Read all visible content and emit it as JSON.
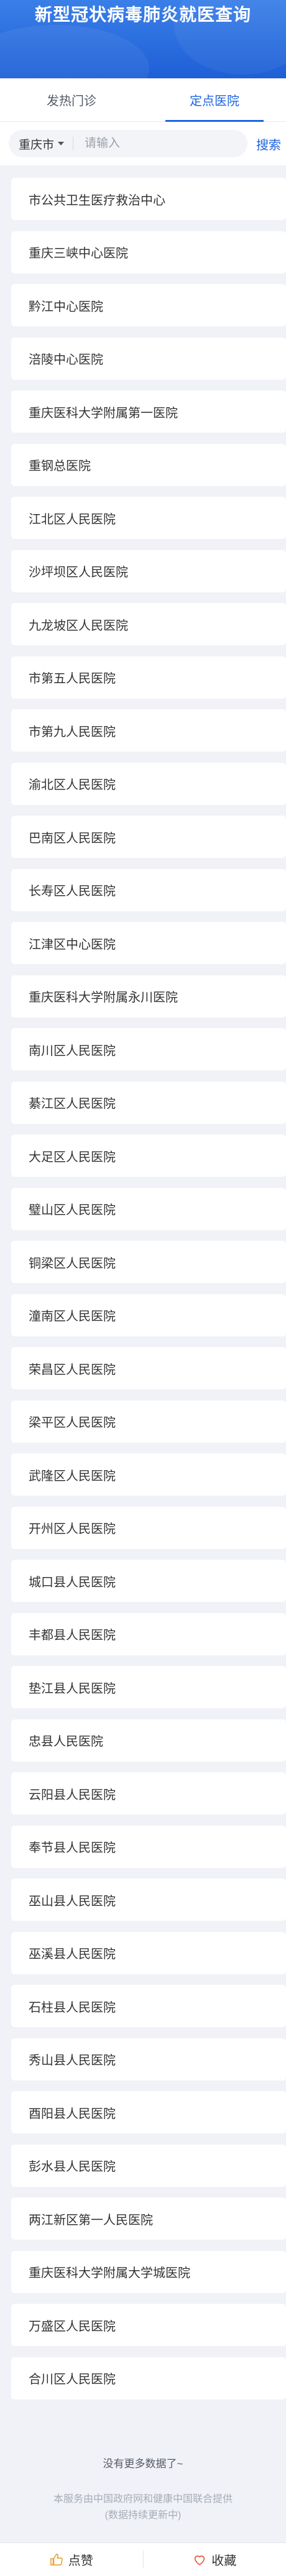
{
  "header": {
    "title": "新型冠状病毒肺炎就医查询"
  },
  "tabs": [
    {
      "label": "发热门诊",
      "active": false
    },
    {
      "label": "定点医院",
      "active": true
    }
  ],
  "search": {
    "city": "重庆市",
    "placeholder": "请输入",
    "button_label": "搜索"
  },
  "hospitals": [
    "市公共卫生医疗救治中心",
    "重庆三峡中心医院",
    "黔江中心医院",
    "涪陵中心医院",
    "重庆医科大学附属第一医院",
    "重钢总医院",
    "江北区人民医院",
    "沙坪坝区人民医院",
    "九龙坡区人民医院",
    "市第五人民医院",
    "市第九人民医院",
    "渝北区人民医院",
    "巴南区人民医院",
    "长寿区人民医院",
    "江津区中心医院",
    "重庆医科大学附属永川医院",
    "南川区人民医院",
    "綦江区人民医院",
    "大足区人民医院",
    "璧山区人民医院",
    "铜梁区人民医院",
    "潼南区人民医院",
    "荣昌区人民医院",
    "梁平区人民医院",
    "武隆区人民医院",
    "开州区人民医院",
    "城口县人民医院",
    "丰都县人民医院",
    "垫江县人民医院",
    "忠县人民医院",
    "云阳县人民医院",
    "奉节县人民医院",
    "巫山县人民医院",
    "巫溪县人民医院",
    "石柱县人民医院",
    "秀山县人民医院",
    "酉阳县人民医院",
    "彭水县人民医院",
    "两江新区第一人民医院",
    "重庆医科大学附属大学城医院",
    "万盛区人民医院",
    "合川区人民医院"
  ],
  "footer": {
    "no_more": "没有更多数据了~",
    "source_line1": "本服务由中国政府网和健康中国联合提供",
    "source_line2": "(数据持续更新中)"
  },
  "bottom_bar": {
    "like_label": "点赞",
    "favorite_label": "收藏"
  },
  "colors": {
    "accent": "#1e64e0",
    "banner": "#2a6fe0",
    "background": "#f0f2f7"
  }
}
